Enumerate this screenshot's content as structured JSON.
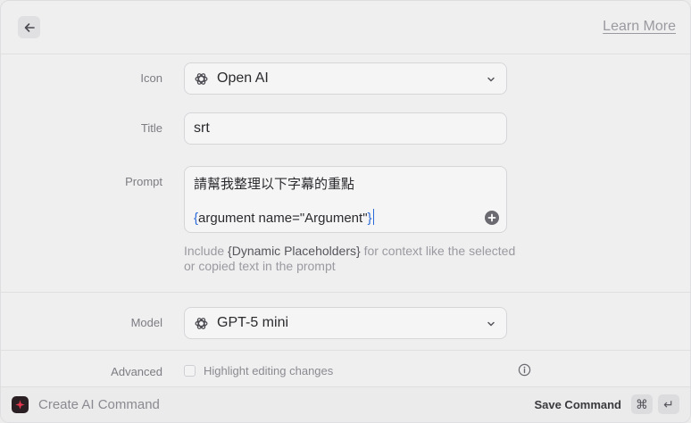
{
  "header": {
    "learn_more": "Learn More"
  },
  "form": {
    "icon": {
      "label": "Icon",
      "value": "Open AI"
    },
    "title": {
      "label": "Title",
      "value": "srt"
    },
    "prompt": {
      "label": "Prompt",
      "line1": "請幫我整理以下字幕的重點",
      "brace_open": "{",
      "placeholder_text": "argument name=\"Argument\"",
      "brace_close": "}"
    },
    "hint": {
      "prefix": "Include ",
      "placeholder": "{Dynamic Placeholders}",
      "suffix": " for context like the selected or copied text in the prompt"
    },
    "model": {
      "label": "Model",
      "value": "GPT-5 mini"
    },
    "advanced": {
      "label": "Advanced",
      "checkbox_label": "Highlight editing changes",
      "checked": false
    }
  },
  "footer": {
    "title": "Create AI Command",
    "save_label": "Save Command",
    "shortcut_cmd": "⌘",
    "shortcut_enter": "↵"
  },
  "colors": {
    "accent_brace": "#2a6ad8",
    "logo_red": "#e8364f"
  }
}
